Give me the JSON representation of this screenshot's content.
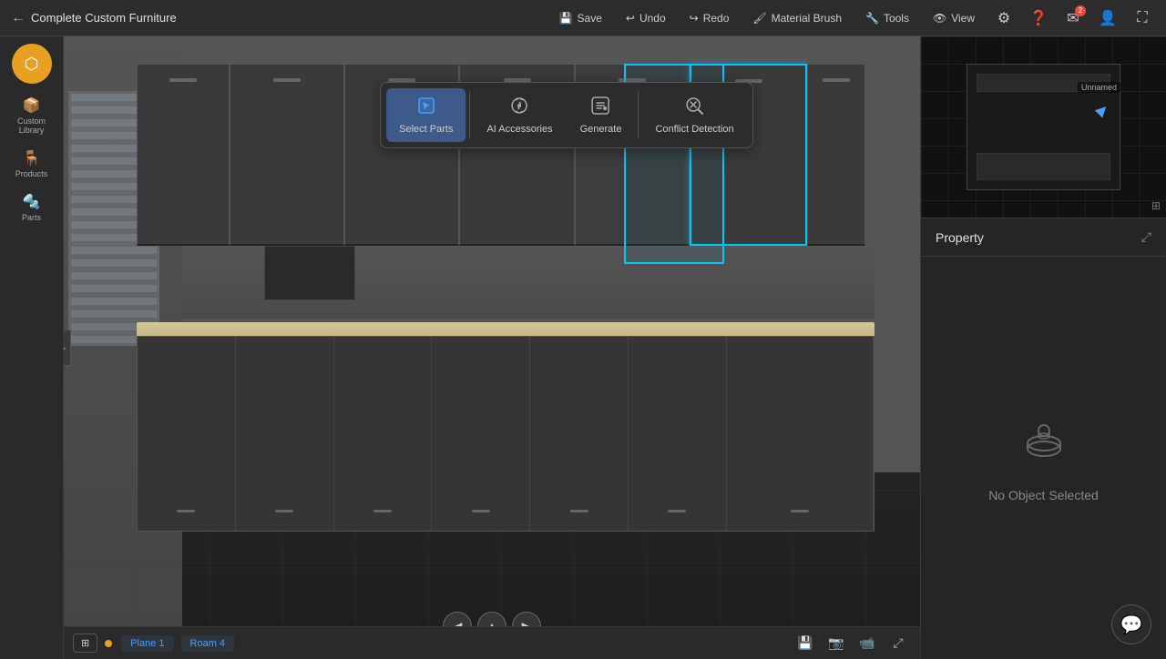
{
  "header": {
    "back_label": "Complete Custom Furniture",
    "tools": [
      {
        "id": "save",
        "label": "Save",
        "icon": "💾"
      },
      {
        "id": "undo",
        "label": "Undo",
        "icon": "↩"
      },
      {
        "id": "redo",
        "label": "Redo",
        "icon": "↪"
      },
      {
        "id": "material-brush",
        "label": "Material Brush",
        "icon": "🖌"
      },
      {
        "id": "tools",
        "label": "Tools",
        "icon": "🔧"
      },
      {
        "id": "view",
        "label": "View",
        "icon": "👁"
      }
    ],
    "icon_buttons": [
      {
        "id": "settings",
        "icon": "⚙",
        "badge": null
      },
      {
        "id": "help",
        "icon": "❓",
        "badge": null
      },
      {
        "id": "notifications",
        "icon": "✉",
        "badge": "2"
      },
      {
        "id": "user",
        "icon": "👤",
        "badge": null
      },
      {
        "id": "expand",
        "icon": "⛶",
        "badge": null
      }
    ]
  },
  "sidebar": {
    "items": [
      {
        "id": "custom-library",
        "icon": "📦",
        "label": "Custom\nLibrary"
      },
      {
        "id": "products",
        "icon": "🪑",
        "label": "Products"
      },
      {
        "id": "parts",
        "icon": "🔩",
        "label": "Parts"
      }
    ]
  },
  "toolbar": {
    "buttons": [
      {
        "id": "select-parts",
        "label": "Select Parts",
        "icon": "↖",
        "active": true
      },
      {
        "id": "ai-accessories",
        "label": "AI Accessories",
        "icon": "✨"
      },
      {
        "id": "generate",
        "label": "Generate",
        "icon": "⚡"
      },
      {
        "id": "conflict-detection",
        "label": "Conflict Detection",
        "icon": "🔍"
      }
    ]
  },
  "minimap": {
    "label": "Unnamed",
    "expand_icon": "⊞"
  },
  "property": {
    "title": "Property",
    "expand_icon": "⤢",
    "empty_text": "No Object Selected",
    "empty_icon": "🪣"
  },
  "bottom_bar": {
    "grid_icon": "⊞",
    "plane_label": "Plane 1",
    "roam_label": "Roam 4",
    "tools": [
      {
        "id": "camera",
        "icon": "📷"
      },
      {
        "id": "record",
        "icon": "📹"
      },
      {
        "id": "fullscreen",
        "icon": "⤢"
      }
    ],
    "save_icon": "💾"
  },
  "chat": {
    "icon": "💬"
  },
  "nav_arrows": {
    "left": "◀",
    "up": "▲",
    "right": "▶"
  }
}
